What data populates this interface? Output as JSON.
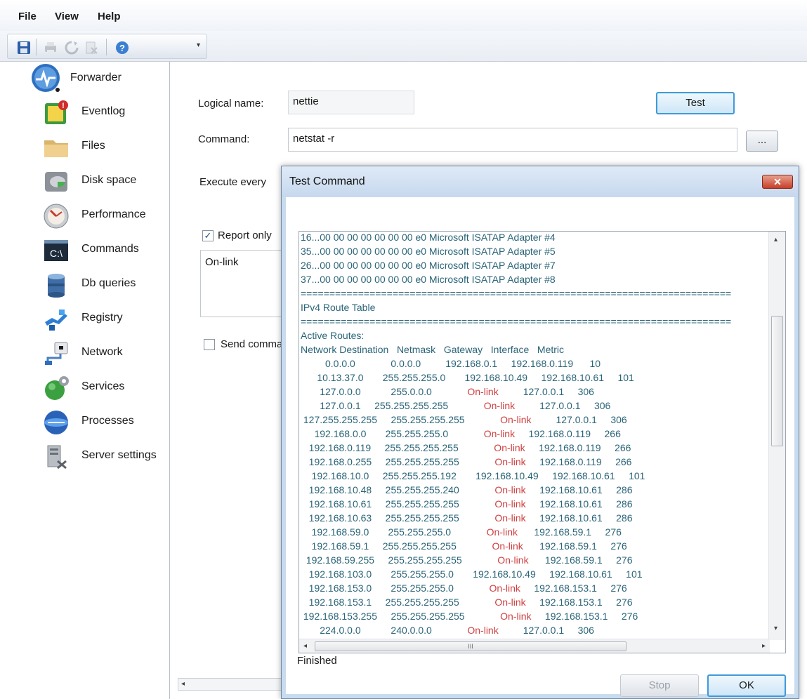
{
  "menu": {
    "file": "File",
    "view": "View",
    "help": "Help"
  },
  "toolbar": {
    "icons": [
      "save-icon",
      "print-icon",
      "refresh-icon",
      "delete-icon",
      "help-icon"
    ],
    "overflow": "▾"
  },
  "sidebar": {
    "root": {
      "label": "Forwarder",
      "icon": "forwarder-icon"
    },
    "items": [
      {
        "label": "Eventlog",
        "icon": "eventlog-icon"
      },
      {
        "label": "Files",
        "icon": "folder-icon"
      },
      {
        "label": "Disk space",
        "icon": "disk-icon"
      },
      {
        "label": "Performance",
        "icon": "gauge-icon"
      },
      {
        "label": "Commands",
        "icon": "console-icon"
      },
      {
        "label": "Db queries",
        "icon": "database-icon"
      },
      {
        "label": "Registry",
        "icon": "registry-icon"
      },
      {
        "label": "Network",
        "icon": "network-icon"
      },
      {
        "label": "Services",
        "icon": "services-icon"
      },
      {
        "label": "Processes",
        "icon": "processes-icon"
      },
      {
        "label": "Server settings",
        "icon": "server-settings-icon"
      }
    ]
  },
  "form": {
    "logical_name_label": "Logical name:",
    "logical_name_value": "nettie",
    "test_button": "Test",
    "command_label": "Command:",
    "command_value": "netstat -r",
    "browse_button": "...",
    "execute_label": "Execute every",
    "report_only_label": "Report only",
    "report_only_checked": true,
    "filter_text": "On-link",
    "send_label": "Send comma",
    "send_checked": false
  },
  "dialog": {
    "title": "Test Command",
    "close": "✕",
    "status": "Finished",
    "stop_button": "Stop",
    "ok_button": "OK",
    "scroll_grip": "III",
    "output": {
      "adapters": [
        "16...00 00 00 00 00 00 00 e0 Microsoft ISATAP Adapter #4",
        "35...00 00 00 00 00 00 00 e0 Microsoft ISATAP Adapter #5",
        "26...00 00 00 00 00 00 00 e0 Microsoft ISATAP Adapter #7",
        "37...00 00 00 00 00 00 00 e0 Microsoft ISATAP Adapter #8"
      ],
      "separator": "===========================================================================",
      "route_table_title": "IPv4 Route Table",
      "active_routes": "Active Routes:",
      "columns": [
        "Network Destination",
        "Netmask",
        "Gateway",
        "Interface",
        "Metric"
      ],
      "routes": [
        [
          "0.0.0.0",
          "0.0.0.0",
          "192.168.0.1",
          "192.168.0.119",
          "10"
        ],
        [
          "10.13.37.0",
          "255.255.255.0",
          "192.168.10.49",
          "192.168.10.61",
          "101"
        ],
        [
          "127.0.0.0",
          "255.0.0.0",
          "On-link",
          "127.0.0.1",
          "306"
        ],
        [
          "127.0.0.1",
          "255.255.255.255",
          "On-link",
          "127.0.0.1",
          "306"
        ],
        [
          "127.255.255.255",
          "255.255.255.255",
          "On-link",
          "127.0.0.1",
          "306"
        ],
        [
          "192.168.0.0",
          "255.255.255.0",
          "On-link",
          "192.168.0.119",
          "266"
        ],
        [
          "192.168.0.119",
          "255.255.255.255",
          "On-link",
          "192.168.0.119",
          "266"
        ],
        [
          "192.168.0.255",
          "255.255.255.255",
          "On-link",
          "192.168.0.119",
          "266"
        ],
        [
          "192.168.10.0",
          "255.255.255.192",
          "192.168.10.49",
          "192.168.10.61",
          "101"
        ],
        [
          "192.168.10.48",
          "255.255.255.240",
          "On-link",
          "192.168.10.61",
          "286"
        ],
        [
          "192.168.10.61",
          "255.255.255.255",
          "On-link",
          "192.168.10.61",
          "286"
        ],
        [
          "192.168.10.63",
          "255.255.255.255",
          "On-link",
          "192.168.10.61",
          "286"
        ],
        [
          "192.168.59.0",
          "255.255.255.0",
          "On-link",
          "192.168.59.1",
          "276"
        ],
        [
          "192.168.59.1",
          "255.255.255.255",
          "On-link",
          "192.168.59.1",
          "276"
        ],
        [
          "192.168.59.255",
          "255.255.255.255",
          "On-link",
          "192.168.59.1",
          "276"
        ],
        [
          "192.168.103.0",
          "255.255.255.0",
          "192.168.10.49",
          "192.168.10.61",
          "101"
        ],
        [
          "192.168.153.0",
          "255.255.255.0",
          "On-link",
          "192.168.153.1",
          "276"
        ],
        [
          "192.168.153.1",
          "255.255.255.255",
          "On-link",
          "192.168.153.1",
          "276"
        ],
        [
          "192.168.153.255",
          "255.255.255.255",
          "On-link",
          "192.168.153.1",
          "276"
        ],
        [
          "224.0.0.0",
          "240.0.0.0",
          "On-link",
          "127.0.0.1",
          "306"
        ]
      ]
    }
  },
  "colors": {
    "onlink": "#d04040",
    "output_text": "#2a6478",
    "dialog_frame": "#c8dcf0"
  }
}
